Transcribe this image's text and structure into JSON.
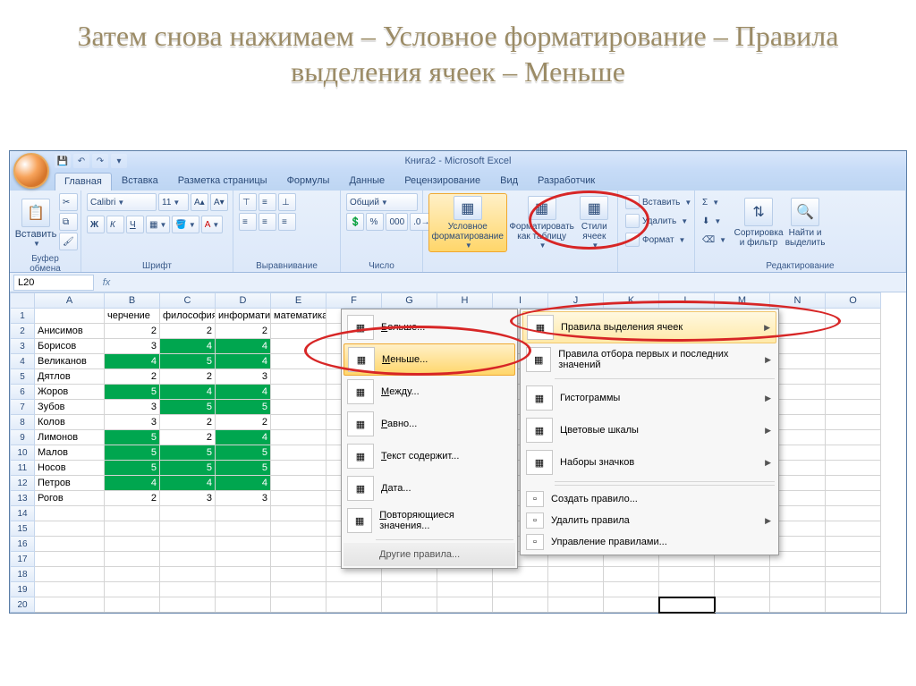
{
  "slide_title": "Затем снова нажимаем – Условное форматирование – Правила выделения ячеек – Меньше",
  "app_title": "Книга2 - Microsoft Excel",
  "tabs": [
    "Главная",
    "Вставка",
    "Разметка страницы",
    "Формулы",
    "Данные",
    "Рецензирование",
    "Вид",
    "Разработчик"
  ],
  "ribbon": {
    "clipboard": {
      "label": "Буфер обмена",
      "paste": "Вставить"
    },
    "font": {
      "label": "Шрифт",
      "name": "Calibri",
      "size": "11"
    },
    "align": {
      "label": "Выравнивание"
    },
    "number": {
      "label": "Число",
      "format": "Общий"
    },
    "styles": {
      "cond": "Условное форматирование",
      "table": "Форматировать как таблицу",
      "cell": "Стили ячеек"
    },
    "cells": {
      "insert": "Вставить",
      "delete": "Удалить",
      "format": "Формат"
    },
    "editing": {
      "label": "Редактирование",
      "sort": "Сортировка и фильтр",
      "find": "Найти и выделить"
    }
  },
  "namebox": "L20",
  "chart_data": {
    "type": "table",
    "columns": [
      "",
      "A",
      "B",
      "C",
      "D",
      "E"
    ],
    "header_row": [
      "",
      "черчение",
      "философия",
      "информатика",
      "математика"
    ],
    "rows": [
      {
        "n": "Анисимов",
        "v": [
          2,
          2,
          2
        ],
        "g": [
          0,
          0,
          0
        ]
      },
      {
        "n": "Борисов",
        "v": [
          3,
          4,
          4
        ],
        "g": [
          0,
          1,
          1
        ]
      },
      {
        "n": "Великанов",
        "v": [
          4,
          5,
          4
        ],
        "g": [
          1,
          1,
          1
        ]
      },
      {
        "n": "Дятлов",
        "v": [
          2,
          2,
          3
        ],
        "g": [
          0,
          0,
          0
        ]
      },
      {
        "n": "Жоров",
        "v": [
          5,
          4,
          4
        ],
        "g": [
          1,
          1,
          1
        ]
      },
      {
        "n": "Зубов",
        "v": [
          3,
          5,
          5
        ],
        "g": [
          0,
          1,
          1
        ]
      },
      {
        "n": "Колов",
        "v": [
          3,
          2,
          2
        ],
        "g": [
          0,
          0,
          0
        ]
      },
      {
        "n": "Лимонов",
        "v": [
          5,
          2,
          4
        ],
        "g": [
          1,
          0,
          1
        ]
      },
      {
        "n": "Малов",
        "v": [
          5,
          5,
          5
        ],
        "g": [
          1,
          1,
          1
        ]
      },
      {
        "n": "Носов",
        "v": [
          5,
          5,
          5
        ],
        "g": [
          1,
          1,
          1
        ]
      },
      {
        "n": "Петров",
        "v": [
          4,
          4,
          4
        ],
        "g": [
          1,
          1,
          1
        ]
      },
      {
        "n": "Рогов",
        "v": [
          2,
          3,
          3
        ],
        "g": [
          0,
          0,
          0
        ]
      }
    ]
  },
  "col_letters": [
    "A",
    "B",
    "C",
    "D",
    "E",
    "F",
    "G",
    "H",
    "I",
    "J",
    "K",
    "L",
    "M",
    "N",
    "O"
  ],
  "sub_menu": {
    "items": [
      "Больше...",
      "Меньше...",
      "Между...",
      "Равно...",
      "Текст содержит...",
      "Дата...",
      "Повторяющиеся значения..."
    ],
    "footer": "Другие правила..."
  },
  "main_menu": {
    "items": [
      "Правила выделения ячеек",
      "Правила отбора первых и последних значений",
      "Гистограммы",
      "Цветовые шкалы",
      "Наборы значков"
    ],
    "footer": [
      "Создать правило...",
      "Удалить правила",
      "Управление правилами..."
    ]
  }
}
